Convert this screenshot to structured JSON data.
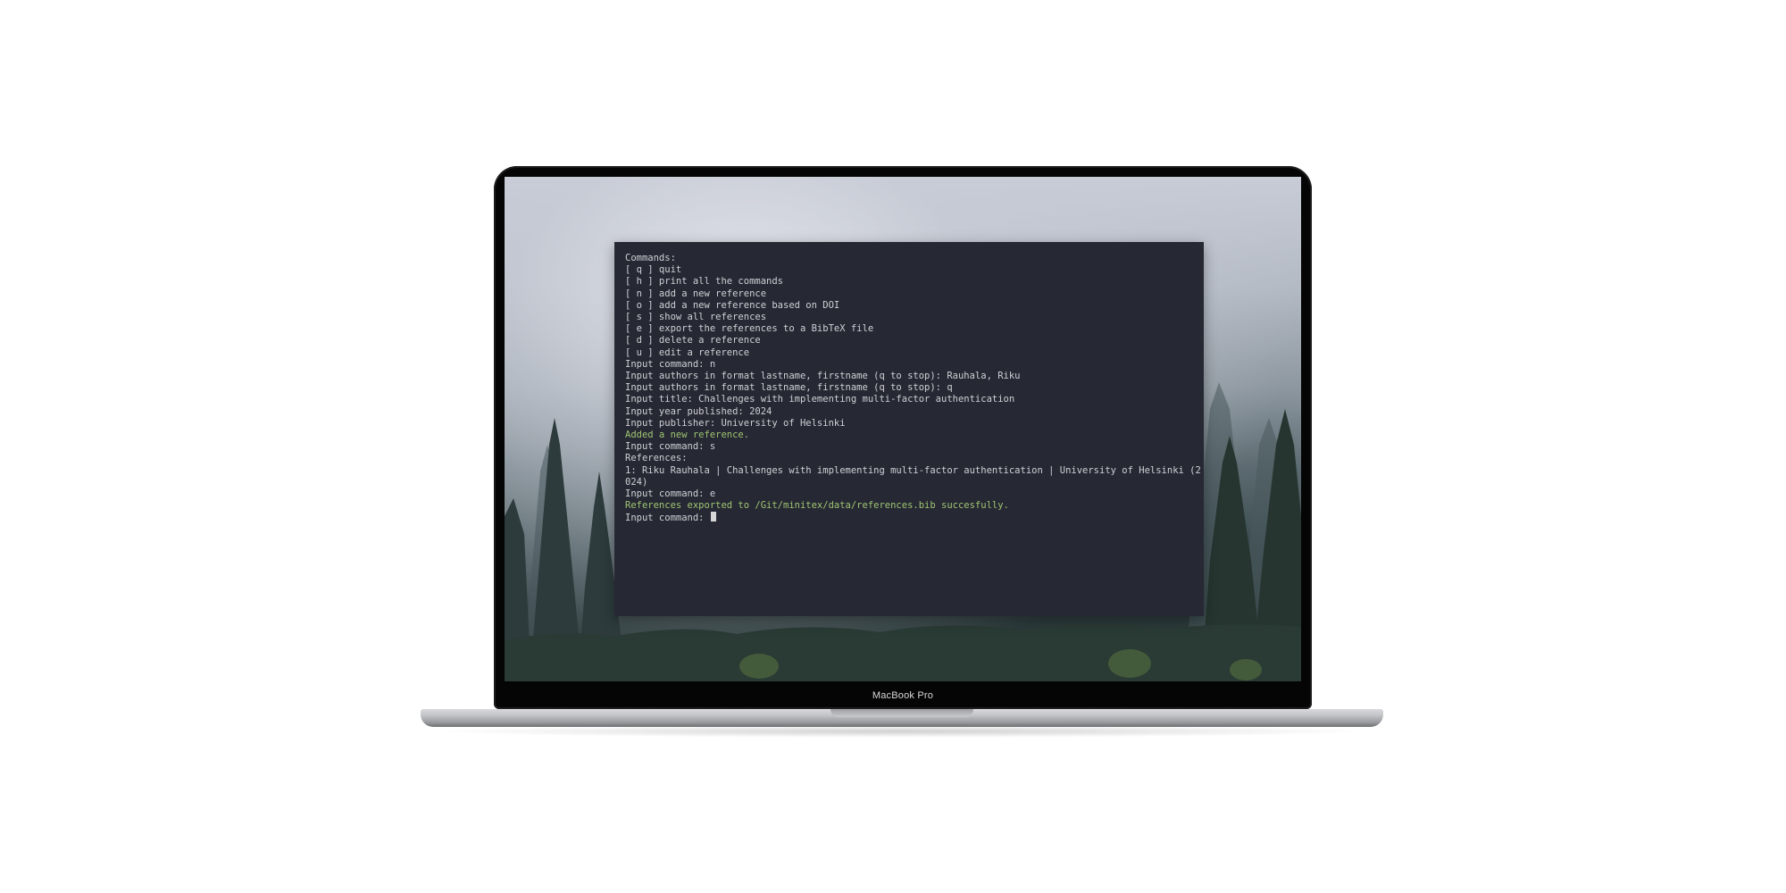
{
  "device": {
    "brand_label": "MacBook Pro"
  },
  "terminal": {
    "lines": [
      {
        "text": "Commands:",
        "color": "default"
      },
      {
        "text": "[ q ] quit",
        "color": "default"
      },
      {
        "text": "[ h ] print all the commands",
        "color": "default"
      },
      {
        "text": "[ n ] add a new reference",
        "color": "default"
      },
      {
        "text": "[ o ] add a new reference based on DOI",
        "color": "default"
      },
      {
        "text": "[ s ] show all references",
        "color": "default"
      },
      {
        "text": "[ e ] export the references to a BibTeX file",
        "color": "default"
      },
      {
        "text": "[ d ] delete a reference",
        "color": "default"
      },
      {
        "text": "[ u ] edit a reference",
        "color": "default"
      },
      {
        "text": "Input command: n",
        "color": "default"
      },
      {
        "text": "Input authors in format lastname, firstname (q to stop): Rauhala, Riku",
        "color": "default"
      },
      {
        "text": "Input authors in format lastname, firstname (q to stop): q",
        "color": "default"
      },
      {
        "text": "Input title: Challenges with implementing multi-factor authentication",
        "color": "default"
      },
      {
        "text": "Input year published: 2024",
        "color": "default"
      },
      {
        "text": "Input publisher: University of Helsinki",
        "color": "default"
      },
      {
        "text": "Added a new reference.",
        "color": "green"
      },
      {
        "text": "Input command: s",
        "color": "default"
      },
      {
        "text": "References:",
        "color": "default"
      },
      {
        "text": "1: Riku Rauhala | Challenges with implementing multi-factor authentication | University of Helsinki (2",
        "color": "default"
      },
      {
        "text": "024)",
        "color": "default"
      },
      {
        "text": "Input command: e",
        "color": "default"
      },
      {
        "text": "References exported to /Git/minitex/data/references.bib succesfully.",
        "color": "green"
      }
    ],
    "prompt": "Input command: ",
    "colors": {
      "background": "#262833",
      "text": "#cfd1d6",
      "success": "#9fc573"
    }
  }
}
